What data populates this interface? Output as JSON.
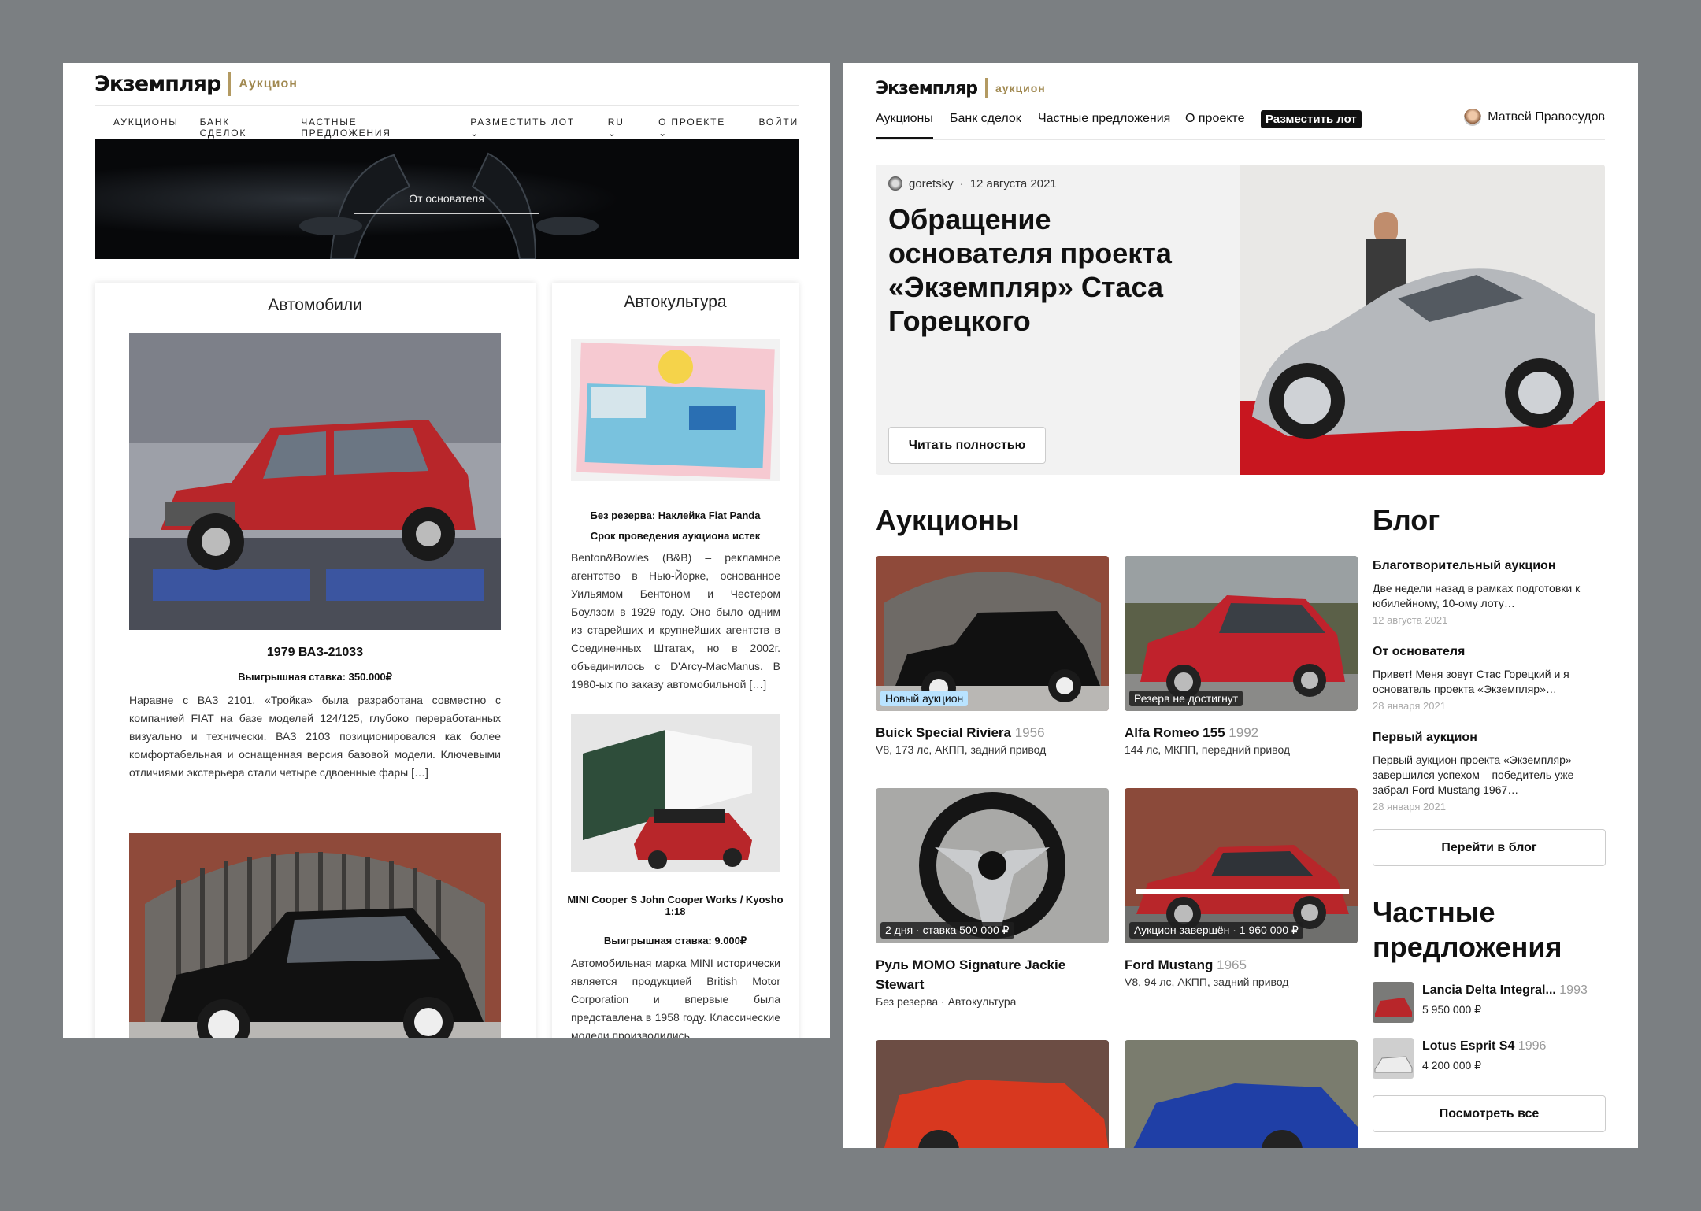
{
  "brand": {
    "name": "Экземпляр",
    "sub": "аукцион"
  },
  "old_site": {
    "nav": [
      "АУКЦИОНЫ",
      "БАНК СДЕЛОК",
      "ЧАСТНЫЕ ПРЕДЛОЖЕНИЯ",
      "РАЗМЕСТИТЬ ЛОТ ⌄",
      "RU ⌄",
      "О ПРОЕКТЕ ⌄",
      "ВОЙТИ"
    ],
    "hero_button": "От основателя",
    "cars": {
      "title": "Автомобили",
      "lot_title": "1979 ВАЗ-21033",
      "lot_bid": "Выигрышная ставка: 350.000₽",
      "lot_text": "Наравне с ВАЗ 2101, «Тройка» была разработана совместно с компанией FIAT на базе моделей 124/125, глубоко переработанных визуально и технически. ВАЗ 2103 позиционировался как более комфортабельная и оснащенная версия базовой модели. Ключевыми отличиями экстерьера стали четыре сдвоенные фары […]"
    },
    "culture": {
      "title": "Автокультура",
      "item1_title": "Без резерва: Наклейка Fiat Panda",
      "item1_status": "Срок проведения аукциона истек",
      "item1_text": "Benton&Bowles (B&B) – рекламное агентство в Нью-Йорке, основанное Уильямом Бентоном и Честером Боулзом в 1929 году. Оно было одним из старейших и крупнейших агентств в Соединенных Штатах, но в 2002г. объединилось с D'Arcy-MacManus. В 1980-ых по заказу автомобильной […]",
      "item2_title": "MINI Cooper S John Cooper Works / Kyosho 1:18",
      "item2_bid": "Выигрышная ставка: 9.000₽",
      "item2_text": "Автомобильная марка MINI исторически является продукцией British Motor Corporation и впервые была представлена в 1958 году. Классические модели производились"
    }
  },
  "new_site": {
    "nav": [
      "Аукционы",
      "Банк сделок",
      "Частные предложения",
      "О проекте"
    ],
    "cta": "Разместить лот",
    "user": "Матвей Правосудов",
    "feature": {
      "author": "goretsky",
      "date": "12 августа 2021",
      "title": "Обращение основателя проекта «Экземпляр» Стаса Горецкого",
      "button": "Читать полностью"
    },
    "auctions_title": "Аукционы",
    "lots": [
      {
        "title": "Buick Special Riviera",
        "year": "1956",
        "sub": "V8, 173 лс, АКПП, задний привод",
        "badge": "Новый аукцион"
      },
      {
        "title": "Alfa Romeo 155",
        "year": "1992",
        "sub": "144 лс, МКПП, передний привод",
        "badge": "Резерв не достигнут"
      },
      {
        "title": "Руль MOMO Signature Jackie Stewart",
        "year": "",
        "sub": "Без резерва · Автокультура",
        "badge": "2 дня · ставка 500 000 ₽"
      },
      {
        "title": "Ford Mustang",
        "year": "1965",
        "sub": "V8, 94 лс, АКПП, задний привод",
        "badge": "Аукцион завершён · 1 960 000 ₽"
      }
    ],
    "blog_title": "Блог",
    "blog": [
      {
        "title": "Благотворительный аукцион",
        "text": "Две недели назад в рамках подготовки к юбилейному, 10-ому лоту…",
        "date": "12 августа 2021"
      },
      {
        "title": "От основателя",
        "text": "Привет! Меня зовут Стас Горецкий и я основатель проекта «Экземпляр»…",
        "date": "28 января 2021"
      },
      {
        "title": "Первый аукцион",
        "text": "Первый аукцион проекта «Экземпляр» завершился успехом – победитель уже забрал Ford Mustang 1967…",
        "date": "28 января 2021"
      }
    ],
    "blog_button": "Перейти в блог",
    "offers_title": "Частные предложения",
    "offers": [
      {
        "title": "Lancia Delta Integral...",
        "year": "1993",
        "price": "5 950 000 ₽"
      },
      {
        "title": "Lotus Esprit S4",
        "year": "1996",
        "price": "4 200 000 ₽"
      }
    ],
    "offers_button": "Посмотреть все"
  },
  "colors": {
    "background": "#7b7f82",
    "accent_gold": "#a0884f",
    "badge_blue": "#b9e3ff",
    "car_red": "#b8262a"
  }
}
